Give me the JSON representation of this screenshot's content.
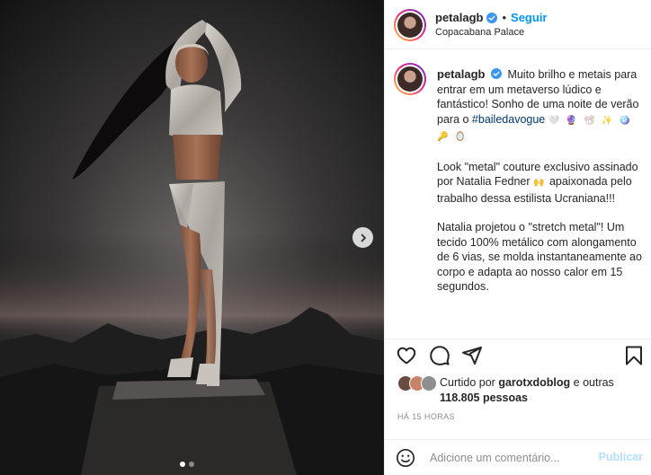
{
  "post": {
    "username": "petalagb",
    "follow_label": "Seguir",
    "separator": "•",
    "location": "Copacabana Palace"
  },
  "caption": {
    "username": "petalagb",
    "p1_text": "Muito brilho e metais para entrar em um metaverso lúdico e fantástico! Sonho de uma noite de verão para o ",
    "p1_hashtag": "#bailedavogue",
    "p1_emojis": "🤍 🔮 📽 ✨ 🪩 🔑 🪞",
    "p2_text": "Look \"metal\" couture exclusivo assinado por Natalia Fedner ",
    "p2_emoji": "🙌",
    "p2_text2": " apaixonada pelo trabalho dessa estilista Ucraniana!!!",
    "p3_text": "Natalia projetou o \"stretch metal\"! Um tecido 100% metálico com alongamento de 6 vias, se molda instantaneamente ao corpo e adapta ao nosso calor em 15 segundos."
  },
  "likes": {
    "prefix": "Curtido por ",
    "user": "garotxdoblog",
    "middle": " e outras ",
    "count": "118.805 pessoas"
  },
  "time_ago": "HÁ 15 HORAS",
  "comment": {
    "placeholder": "Adicione um comentário...",
    "post_label": "Publicar"
  },
  "carousel": {
    "current_index": 1,
    "total": 2
  },
  "icons": {
    "verified": "verified-badge-icon",
    "like": "heart-icon",
    "comment": "comment-icon",
    "share": "paper-plane-icon",
    "save": "bookmark-icon",
    "emoji": "smiley-icon",
    "next": "chevron-right-icon"
  },
  "colors": {
    "accent": "#0095f6",
    "hashtag": "#00376b",
    "muted": "#8e8e8e",
    "post_disabled": "#b2dffc"
  }
}
